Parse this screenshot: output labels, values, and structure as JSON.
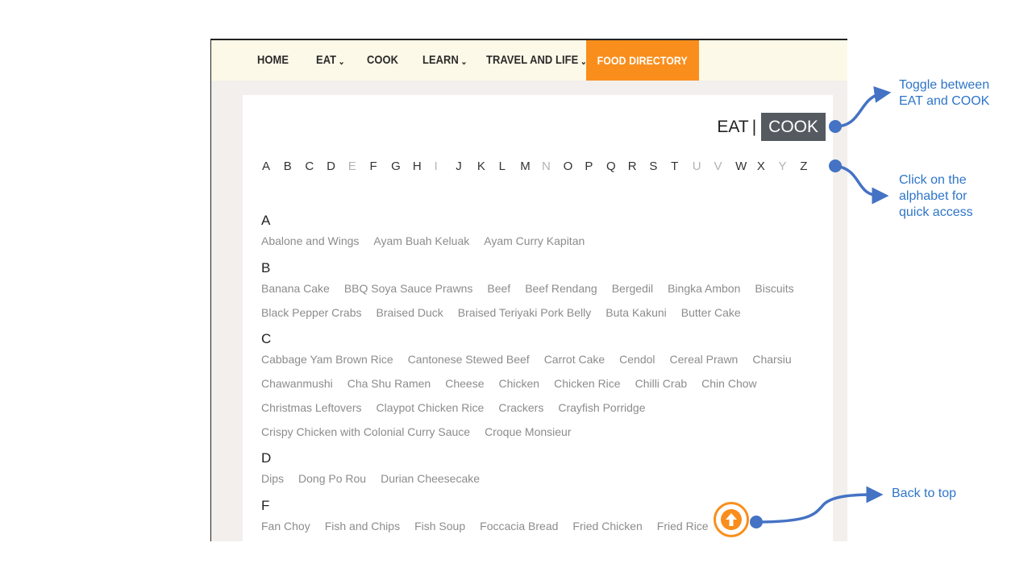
{
  "nav": {
    "items": [
      {
        "label": "HOME",
        "has_dropdown": false
      },
      {
        "label": "EAT",
        "has_dropdown": true
      },
      {
        "label": "COOK",
        "has_dropdown": false
      },
      {
        "label": "LEARN",
        "has_dropdown": true
      },
      {
        "label": "TRAVEL AND LIFE",
        "has_dropdown": true
      },
      {
        "label": "FOOD DIRECTORY",
        "has_dropdown": false,
        "active": true
      }
    ],
    "chevron": "⌄"
  },
  "toggle": {
    "eat": "EAT",
    "separator": "|",
    "cook": "COOK",
    "selected": "COOK"
  },
  "alphabet": [
    {
      "l": "A",
      "on": true
    },
    {
      "l": "B",
      "on": true
    },
    {
      "l": "C",
      "on": true
    },
    {
      "l": "D",
      "on": true
    },
    {
      "l": "E",
      "on": false
    },
    {
      "l": "F",
      "on": true
    },
    {
      "l": "G",
      "on": true
    },
    {
      "l": "H",
      "on": true
    },
    {
      "l": "I",
      "on": false
    },
    {
      "l": "J",
      "on": true
    },
    {
      "l": "K",
      "on": true
    },
    {
      "l": "L",
      "on": true
    },
    {
      "l": "M",
      "on": true
    },
    {
      "l": "N",
      "on": false
    },
    {
      "l": "O",
      "on": true
    },
    {
      "l": "P",
      "on": true
    },
    {
      "l": "Q",
      "on": true
    },
    {
      "l": "R",
      "on": true
    },
    {
      "l": "S",
      "on": true
    },
    {
      "l": "T",
      "on": true
    },
    {
      "l": "U",
      "on": false
    },
    {
      "l": "V",
      "on": false
    },
    {
      "l": "W",
      "on": true
    },
    {
      "l": "X",
      "on": true
    },
    {
      "l": "Y",
      "on": false
    },
    {
      "l": "Z",
      "on": true
    }
  ],
  "sections": [
    {
      "letter": "A",
      "rows": [
        [
          "Abalone and Wings",
          "Ayam Buah Keluak",
          "Ayam Curry Kapitan"
        ]
      ]
    },
    {
      "letter": "B",
      "rows": [
        [
          "Banana Cake",
          "BBQ Soya Sauce Prawns",
          "Beef",
          "Beef Rendang",
          "Bergedil",
          "Bingka Ambon",
          "Biscuits"
        ],
        [
          "Black Pepper Crabs",
          "Braised Duck",
          "Braised Teriyaki Pork Belly",
          "Buta Kakuni",
          "Butter Cake"
        ]
      ]
    },
    {
      "letter": "C",
      "rows": [
        [
          "Cabbage Yam Brown Rice",
          "Cantonese Stewed Beef",
          "Carrot Cake",
          "Cendol",
          "Cereal Prawn",
          "Charsiu"
        ],
        [
          "Chawanmushi",
          "Cha Shu Ramen",
          "Cheese",
          "Chicken",
          "Chicken Rice",
          "Chilli Crab",
          "Chin Chow"
        ],
        [
          "Christmas Leftovers",
          "Claypot Chicken Rice",
          "Crackers",
          "Crayfish Porridge"
        ],
        [
          "Crispy Chicken with Colonial Curry Sauce",
          "Croque Monsieur"
        ]
      ]
    },
    {
      "letter": "D",
      "rows": [
        [
          "Dips",
          "Dong Po Rou",
          "Durian Cheesecake"
        ]
      ]
    },
    {
      "letter": "F",
      "rows": [
        [
          "Fan Choy",
          "Fish and Chips",
          "Fish Soup",
          "Foccacia Bread",
          "Fried Chicken",
          "Fried Rice"
        ]
      ]
    }
  ],
  "annotations": {
    "toggle": [
      "Toggle between",
      "EAT and COOK"
    ],
    "alphabet": [
      "Click on the",
      "alphabet for",
      "quick access"
    ],
    "back_to_top": [
      "Back to top"
    ]
  },
  "colors": {
    "accent": "#f98e1c",
    "annotation": "#2e75c8",
    "toggle_bg": "#555a61"
  },
  "icons": {
    "back_to_top": "arrow-up-circle-icon"
  }
}
